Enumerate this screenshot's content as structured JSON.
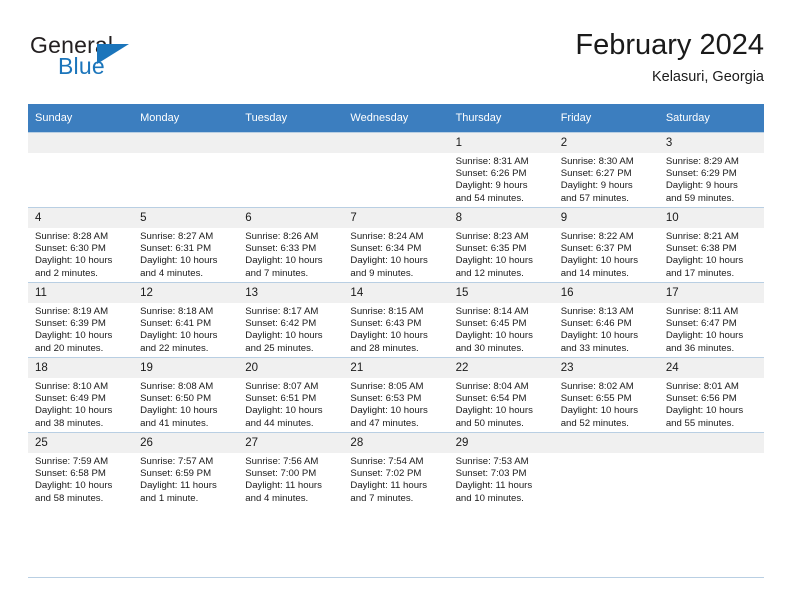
{
  "brand": {
    "line1": "General",
    "line2": "Blue",
    "accent_color": "#1b75bb",
    "triangle_icon": "triangle-icon"
  },
  "header": {
    "title": "February 2024",
    "subtitle": "Kelasuri, Georgia"
  },
  "calendar": {
    "header_color": "#3c7ebf",
    "daynum_band_color": "#f0f0f0",
    "row_border_color": "#b9cfe3",
    "weekday_headers": [
      "Sunday",
      "Monday",
      "Tuesday",
      "Wednesday",
      "Thursday",
      "Friday",
      "Saturday"
    ],
    "weeks": [
      [
        {
          "day": "",
          "lines": []
        },
        {
          "day": "",
          "lines": []
        },
        {
          "day": "",
          "lines": []
        },
        {
          "day": "",
          "lines": []
        },
        {
          "day": "1",
          "lines": [
            "Sunrise: 8:31 AM",
            "Sunset: 6:26 PM",
            "Daylight: 9 hours",
            "and 54 minutes."
          ]
        },
        {
          "day": "2",
          "lines": [
            "Sunrise: 8:30 AM",
            "Sunset: 6:27 PM",
            "Daylight: 9 hours",
            "and 57 minutes."
          ]
        },
        {
          "day": "3",
          "lines": [
            "Sunrise: 8:29 AM",
            "Sunset: 6:29 PM",
            "Daylight: 9 hours",
            "and 59 minutes."
          ]
        }
      ],
      [
        {
          "day": "4",
          "lines": [
            "Sunrise: 8:28 AM",
            "Sunset: 6:30 PM",
            "Daylight: 10 hours",
            "and 2 minutes."
          ]
        },
        {
          "day": "5",
          "lines": [
            "Sunrise: 8:27 AM",
            "Sunset: 6:31 PM",
            "Daylight: 10 hours",
            "and 4 minutes."
          ]
        },
        {
          "day": "6",
          "lines": [
            "Sunrise: 8:26 AM",
            "Sunset: 6:33 PM",
            "Daylight: 10 hours",
            "and 7 minutes."
          ]
        },
        {
          "day": "7",
          "lines": [
            "Sunrise: 8:24 AM",
            "Sunset: 6:34 PM",
            "Daylight: 10 hours",
            "and 9 minutes."
          ]
        },
        {
          "day": "8",
          "lines": [
            "Sunrise: 8:23 AM",
            "Sunset: 6:35 PM",
            "Daylight: 10 hours",
            "and 12 minutes."
          ]
        },
        {
          "day": "9",
          "lines": [
            "Sunrise: 8:22 AM",
            "Sunset: 6:37 PM",
            "Daylight: 10 hours",
            "and 14 minutes."
          ]
        },
        {
          "day": "10",
          "lines": [
            "Sunrise: 8:21 AM",
            "Sunset: 6:38 PM",
            "Daylight: 10 hours",
            "and 17 minutes."
          ]
        }
      ],
      [
        {
          "day": "11",
          "lines": [
            "Sunrise: 8:19 AM",
            "Sunset: 6:39 PM",
            "Daylight: 10 hours",
            "and 20 minutes."
          ]
        },
        {
          "day": "12",
          "lines": [
            "Sunrise: 8:18 AM",
            "Sunset: 6:41 PM",
            "Daylight: 10 hours",
            "and 22 minutes."
          ]
        },
        {
          "day": "13",
          "lines": [
            "Sunrise: 8:17 AM",
            "Sunset: 6:42 PM",
            "Daylight: 10 hours",
            "and 25 minutes."
          ]
        },
        {
          "day": "14",
          "lines": [
            "Sunrise: 8:15 AM",
            "Sunset: 6:43 PM",
            "Daylight: 10 hours",
            "and 28 minutes."
          ]
        },
        {
          "day": "15",
          "lines": [
            "Sunrise: 8:14 AM",
            "Sunset: 6:45 PM",
            "Daylight: 10 hours",
            "and 30 minutes."
          ]
        },
        {
          "day": "16",
          "lines": [
            "Sunrise: 8:13 AM",
            "Sunset: 6:46 PM",
            "Daylight: 10 hours",
            "and 33 minutes."
          ]
        },
        {
          "day": "17",
          "lines": [
            "Sunrise: 8:11 AM",
            "Sunset: 6:47 PM",
            "Daylight: 10 hours",
            "and 36 minutes."
          ]
        }
      ],
      [
        {
          "day": "18",
          "lines": [
            "Sunrise: 8:10 AM",
            "Sunset: 6:49 PM",
            "Daylight: 10 hours",
            "and 38 minutes."
          ]
        },
        {
          "day": "19",
          "lines": [
            "Sunrise: 8:08 AM",
            "Sunset: 6:50 PM",
            "Daylight: 10 hours",
            "and 41 minutes."
          ]
        },
        {
          "day": "20",
          "lines": [
            "Sunrise: 8:07 AM",
            "Sunset: 6:51 PM",
            "Daylight: 10 hours",
            "and 44 minutes."
          ]
        },
        {
          "day": "21",
          "lines": [
            "Sunrise: 8:05 AM",
            "Sunset: 6:53 PM",
            "Daylight: 10 hours",
            "and 47 minutes."
          ]
        },
        {
          "day": "22",
          "lines": [
            "Sunrise: 8:04 AM",
            "Sunset: 6:54 PM",
            "Daylight: 10 hours",
            "and 50 minutes."
          ]
        },
        {
          "day": "23",
          "lines": [
            "Sunrise: 8:02 AM",
            "Sunset: 6:55 PM",
            "Daylight: 10 hours",
            "and 52 minutes."
          ]
        },
        {
          "day": "24",
          "lines": [
            "Sunrise: 8:01 AM",
            "Sunset: 6:56 PM",
            "Daylight: 10 hours",
            "and 55 minutes."
          ]
        }
      ],
      [
        {
          "day": "25",
          "lines": [
            "Sunrise: 7:59 AM",
            "Sunset: 6:58 PM",
            "Daylight: 10 hours",
            "and 58 minutes."
          ]
        },
        {
          "day": "26",
          "lines": [
            "Sunrise: 7:57 AM",
            "Sunset: 6:59 PM",
            "Daylight: 11 hours",
            "and 1 minute."
          ]
        },
        {
          "day": "27",
          "lines": [
            "Sunrise: 7:56 AM",
            "Sunset: 7:00 PM",
            "Daylight: 11 hours",
            "and 4 minutes."
          ]
        },
        {
          "day": "28",
          "lines": [
            "Sunrise: 7:54 AM",
            "Sunset: 7:02 PM",
            "Daylight: 11 hours",
            "and 7 minutes."
          ]
        },
        {
          "day": "29",
          "lines": [
            "Sunrise: 7:53 AM",
            "Sunset: 7:03 PM",
            "Daylight: 11 hours",
            "and 10 minutes."
          ]
        },
        {
          "day": "",
          "lines": []
        },
        {
          "day": "",
          "lines": []
        }
      ]
    ]
  }
}
